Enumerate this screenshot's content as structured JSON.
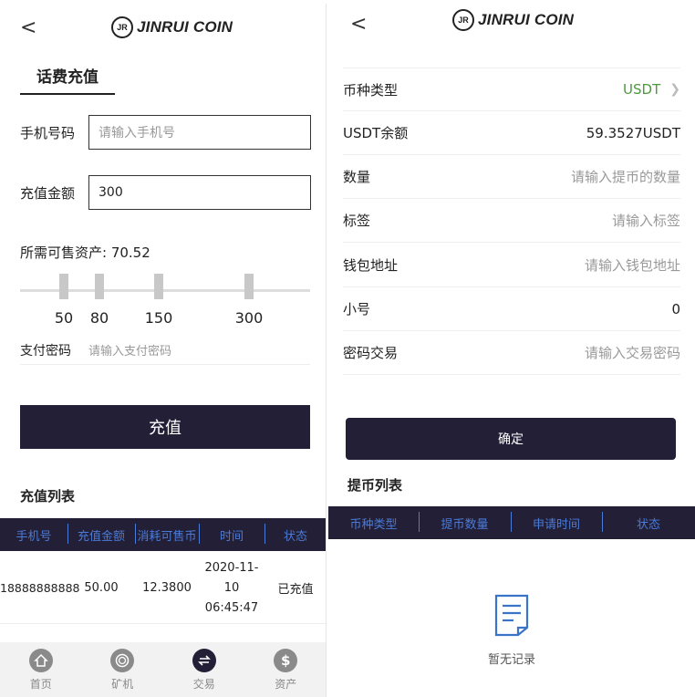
{
  "brand": {
    "name": "JINRUI COIN",
    "mark": "JR",
    "back_glyph": "<"
  },
  "left": {
    "title": "话费充值",
    "phone": {
      "label": "手机号码",
      "placeholder": "请输入手机号"
    },
    "amount": {
      "label": "充值金额",
      "value": "300"
    },
    "assets": "所需可售资产: 70.52",
    "slider": {
      "options": [
        "50",
        "80",
        "150",
        "300"
      ]
    },
    "pay_password": {
      "label": "支付密码",
      "placeholder": "请输入支付密码"
    },
    "submit_label": "充值",
    "list_title": "充值列表",
    "table": {
      "headers": [
        "手机号",
        "充值金额",
        "消耗可售币",
        "时间",
        "状态"
      ],
      "rows": [
        {
          "phone": "18888888888",
          "amount": "50.00",
          "consumed": "12.3800",
          "date": "2020-11-10",
          "time": "06:45:47",
          "status": "已充值"
        }
      ]
    },
    "tabbar": [
      {
        "label": "首页",
        "icon": "home-icon",
        "color": "#8a8a8a"
      },
      {
        "label": "矿机",
        "icon": "miner-icon",
        "color": "#8a8a8a"
      },
      {
        "label": "交易",
        "icon": "trade-icon",
        "color": "#221f37"
      },
      {
        "label": "资产",
        "icon": "assets-icon",
        "color": "#8a8a8a"
      }
    ]
  },
  "right": {
    "rows": [
      {
        "label": "币种类型",
        "value": "USDT"
      },
      {
        "label": "USDT余额",
        "value": "59.3527USDT"
      },
      {
        "label": "数量",
        "value": "请输入提币的数量"
      },
      {
        "label": "标签",
        "value": "请输入标签"
      },
      {
        "label": "钱包地址",
        "value": "请输入钱包地址"
      },
      {
        "label": "小号",
        "value": "0"
      },
      {
        "label": "密码交易",
        "value": "请输入交易密码"
      }
    ],
    "confirm_label": "确定",
    "list_title": "提币列表",
    "table_headers": [
      "币种类型",
      "提币数量",
      "申请时间",
      "状态"
    ],
    "empty_label": "暂无记录"
  },
  "colors": {
    "dark": "#221f37",
    "header_text": "#4a7bd8",
    "accent_green": "#4a9b3a"
  }
}
